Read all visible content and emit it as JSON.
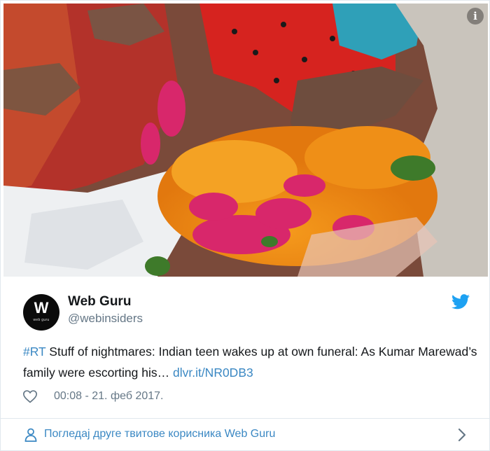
{
  "author": {
    "name": "Web Guru",
    "handle": "@webinsiders",
    "avatar_letter": "W",
    "avatar_sub": "web guru"
  },
  "tweet": {
    "hashtag": "#RT",
    "text": " Stuff of nightmares: Indian teen wakes up at own funeral: As Kumar Marewad’s family were escorting his… ",
    "link": "dlvr.it/NR0DB3",
    "timestamp": "00:08 - 21. феб 2017."
  },
  "footer": {
    "more_tweets_label": "Погледај друге твитове корисника Web Guru"
  },
  "icons": {
    "info": "info-icon",
    "twitter": "twitter-bird-icon",
    "like": "heart-icon",
    "profile": "person-icon",
    "next": "chevron-right-icon"
  },
  "colors": {
    "link": "#3b88c3",
    "twitter_blue": "#1da1f2",
    "muted": "#657786",
    "border": "#e1e8ed"
  }
}
